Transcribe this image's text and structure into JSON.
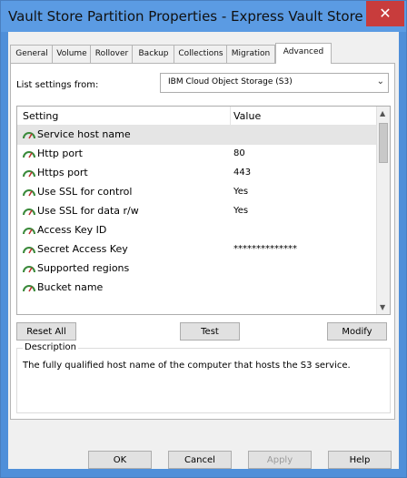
{
  "window": {
    "title": "Vault Store Partition Properties - Express Vault Store ...",
    "close_label": "✕"
  },
  "tabs": [
    {
      "label": "General",
      "active": false
    },
    {
      "label": "Volume",
      "active": false
    },
    {
      "label": "Rollover",
      "active": false
    },
    {
      "label": "Backup",
      "active": false
    },
    {
      "label": "Collections",
      "active": false
    },
    {
      "label": "Migration",
      "active": false
    },
    {
      "label": "Advanced",
      "active": true
    }
  ],
  "list_settings": {
    "label": "List settings from:",
    "value": "IBM Cloud Object Storage (S3)"
  },
  "settings_table": {
    "columns": [
      "Setting",
      "Value"
    ],
    "rows": [
      {
        "setting": "Service host name",
        "value": "",
        "selected": true
      },
      {
        "setting": "Http port",
        "value": "80"
      },
      {
        "setting": "Https port",
        "value": "443"
      },
      {
        "setting": "Use SSL for control",
        "value": "Yes"
      },
      {
        "setting": "Use SSL for data r/w",
        "value": "Yes"
      },
      {
        "setting": "Access Key ID",
        "value": ""
      },
      {
        "setting": "Secret Access Key",
        "value": "**************"
      },
      {
        "setting": "Supported regions",
        "value": ""
      },
      {
        "setting": "Bucket name",
        "value": ""
      }
    ]
  },
  "buttons": {
    "reset_all": "Reset All",
    "test": "Test",
    "modify": "Modify",
    "ok": "OK",
    "cancel": "Cancel",
    "apply": "Apply",
    "help": "Help"
  },
  "description": {
    "legend": "Description",
    "text": "The fully qualified host name of the computer that hosts the S3 service."
  },
  "colors": {
    "title_bar": "#5b9be3",
    "close_button": "#c83c3c",
    "selected_row": "#e5e5e5"
  }
}
